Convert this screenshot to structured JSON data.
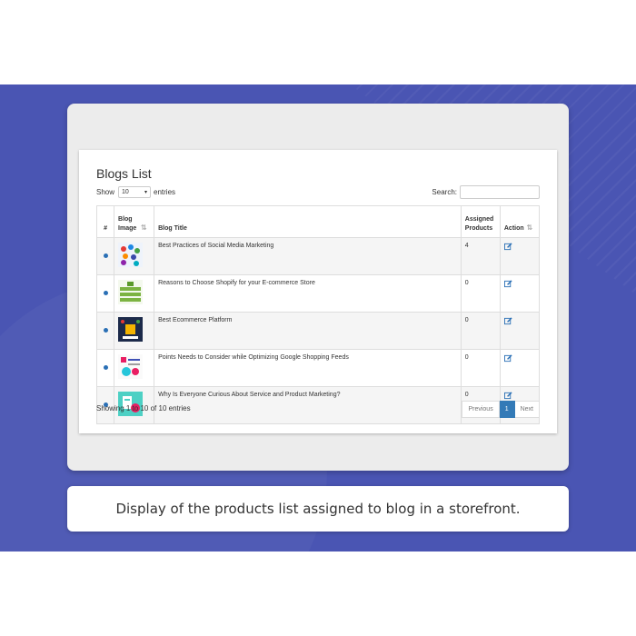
{
  "blogs_list": {
    "title": "Blogs List",
    "show_label": "Show",
    "entries_value": "10",
    "entries_label": "entries",
    "search_label": "Search:",
    "search_value": "",
    "columns": {
      "num": "#",
      "image": "Blog Image",
      "title": "Blog Title",
      "assigned": "Assigned Products",
      "action": "Action"
    },
    "rows": [
      {
        "title": "Best Practices of Social Media Marketing",
        "assigned": "4",
        "thumb": "social-media-thumbnail"
      },
      {
        "title": "Reasons to Choose Shopify for your E-commerce Store",
        "assigned": "0",
        "thumb": "shopify-thumbnail"
      },
      {
        "title": "Best Ecommerce Platform",
        "assigned": "0",
        "thumb": "ecommerce-platform-thumbnail"
      },
      {
        "title": "Points Needs to Consider while Optimizing Google Shopping Feeds",
        "assigned": "0",
        "thumb": "google-shopping-thumbnail"
      },
      {
        "title": "Why Is Everyone Curious About Service and Product Marketing?",
        "assigned": "0",
        "thumb": "product-marketing-thumbnail"
      }
    ],
    "info": "Showing 1 to 10 of 10 entries",
    "pagination": {
      "previous": "Previous",
      "current": "1",
      "next": "Next"
    }
  },
  "caption": "Display of the products list assigned to blog in a storefront.",
  "colors": {
    "band": "#4a55b3",
    "accent": "#337ab7"
  }
}
